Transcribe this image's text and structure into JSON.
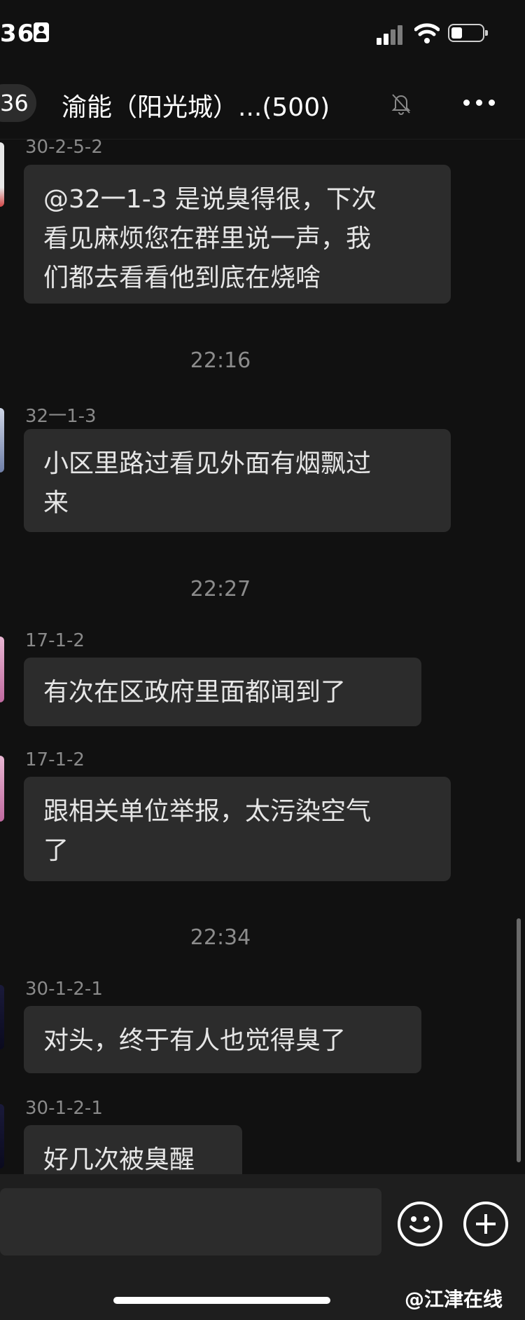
{
  "status_bar": {
    "time": "36",
    "icons": [
      "contact-card-icon",
      "signal-icon",
      "wifi-icon",
      "battery-icon"
    ]
  },
  "header": {
    "back_count": "36",
    "title": "渝能（阳光城）...",
    "member_count": "(500)",
    "icons": [
      "bell-off-icon",
      "more-icon"
    ]
  },
  "messages": [
    {
      "sender": "30-2-5-2",
      "lines": [
        "@32一1-3 是说臭得很，下次",
        "看见麻烦您在群里说一声，我",
        "们都去看看他到底在烧啥"
      ]
    },
    {
      "timestamp": "22:16"
    },
    {
      "sender": "32一1-3",
      "lines": [
        "小区里路过看见外面有烟飘过",
        "来"
      ]
    },
    {
      "timestamp": "22:27"
    },
    {
      "sender": "17-1-2",
      "lines": [
        "有次在区政府里面都闻到了"
      ]
    },
    {
      "sender": "17-1-2",
      "lines": [
        "跟相关单位举报，太污染空气",
        "了"
      ]
    },
    {
      "timestamp": "22:34"
    },
    {
      "sender": "30-1-2-1",
      "lines": [
        "对头，终于有人也觉得臭了"
      ]
    },
    {
      "sender": "30-1-2-1",
      "lines": [
        "好几次被臭醒"
      ]
    }
  ],
  "input_bar": {
    "icons": [
      "emoji-icon",
      "plus-icon"
    ]
  },
  "watermark": "@江津在线",
  "colors": {
    "background": "#111111",
    "bubble": "#2c2c2c",
    "text": "#e6e6e6",
    "meta": "#8a8a8a"
  }
}
